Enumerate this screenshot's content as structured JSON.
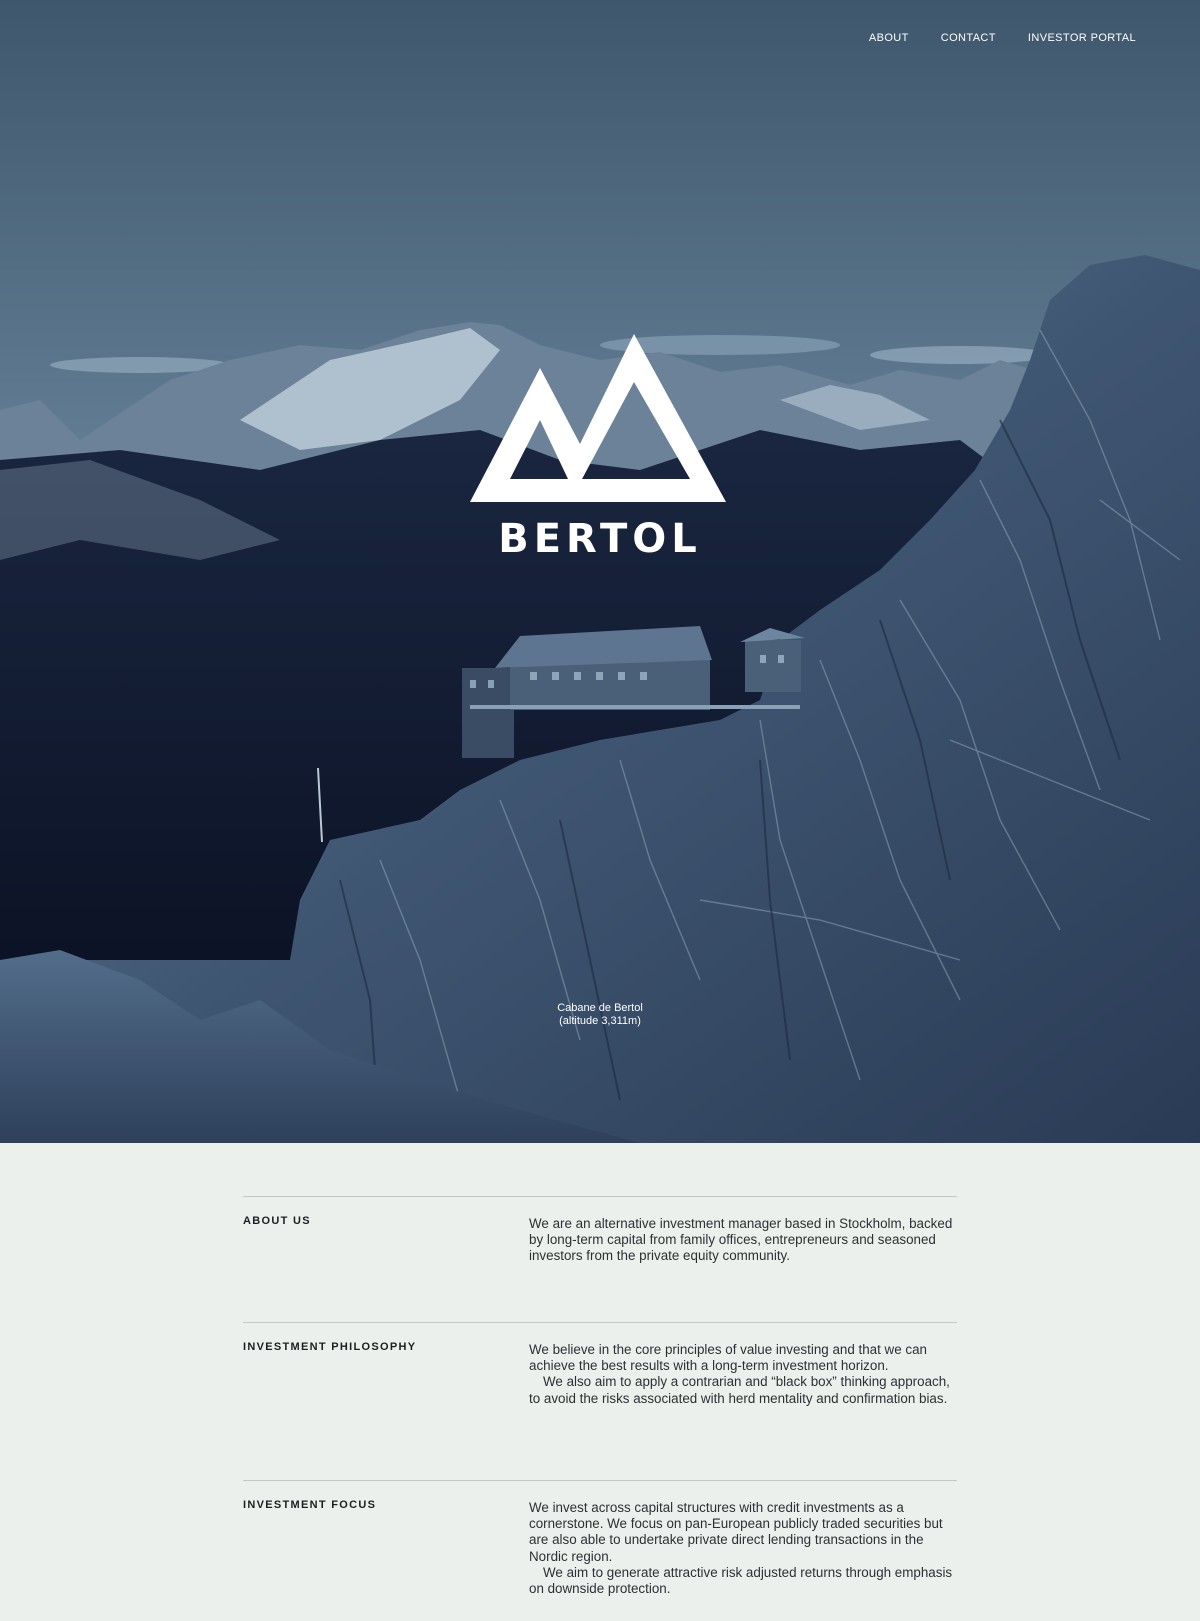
{
  "nav": {
    "about": "ABOUT",
    "contact": "CONTACT",
    "investor_portal": "INVESTOR PORTAL"
  },
  "hero": {
    "brand": "BERTOL",
    "caption_line1": "Cabane de Bertol",
    "caption_line2": "(altitude 3,311m)"
  },
  "sections": [
    {
      "heading": "ABOUT US",
      "paragraphs": [
        "We are an alternative investment manager based in Stockholm, backed by long-term capital from family offices, entrepreneurs and seasoned investors from the private equity community."
      ]
    },
    {
      "heading": "INVESTMENT PHILOSOPHY",
      "paragraphs": [
        "We believe in the core principles of value investing and that we can achieve the best results with a long-term investment horizon.",
        "We also aim to apply a contrarian and “black box” thinking approach, to avoid the risks associated with herd mentality and confirmation bias."
      ]
    },
    {
      "heading": "INVESTMENT FOCUS",
      "paragraphs": [
        "We invest across capital structures with credit investments as a cornerstone. We focus on pan-European publicly traded securities but are also able to undertake private direct lending transactions in the Nordic region.",
        "We aim to generate attractive risk adjusted returns through emphasis on downside protection."
      ]
    }
  ],
  "colors": {
    "page_background": "#ecf0ed",
    "sky_top": "#41596f",
    "sky_horizon": "#8aa7bd",
    "valley_dark": "#0b1226",
    "rock": "#4c6580",
    "text_dark": "#2b3034",
    "divider": "#c2c7c5"
  }
}
